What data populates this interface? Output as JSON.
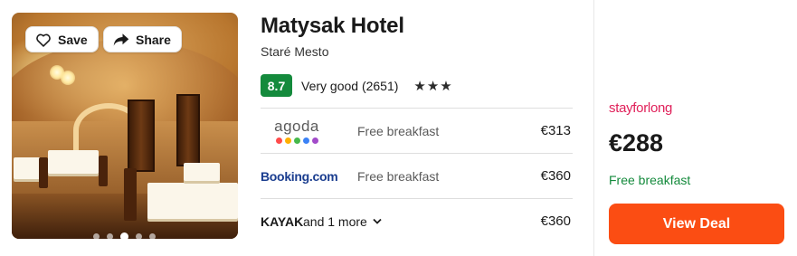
{
  "hotel": {
    "name": "Matysak Hotel",
    "location": "Staré Mesto",
    "score": "8.7",
    "rating_label": "Very good (2651)",
    "stars": "★★★"
  },
  "photo": {
    "save_label": "Save",
    "share_label": "Share",
    "slide_count": 5,
    "active_slide": 3
  },
  "offers": [
    {
      "provider": "agoda",
      "note": "Free breakfast",
      "price": "€313"
    },
    {
      "provider": "Booking.com",
      "provider_main": "Booking",
      "provider_suffix": ".com",
      "note": "Free breakfast",
      "price": "€360"
    },
    {
      "provider": "KAYAK",
      "more_label": "and 1 more",
      "price": "€360"
    }
  ],
  "agoda_colors": [
    "#ff4b4b",
    "#ffb000",
    "#46b94b",
    "#3b82f6",
    "#a24bc9"
  ],
  "best_deal": {
    "provider": "stayforlong",
    "price": "€288",
    "note": "Free breakfast",
    "button_label": "View Deal"
  },
  "colors": {
    "score_bg": "#148a3c",
    "deal_button": "#fb4d13",
    "free_breakfast_green": "#148a3c",
    "stayforlong_pink": "#e0215a"
  }
}
